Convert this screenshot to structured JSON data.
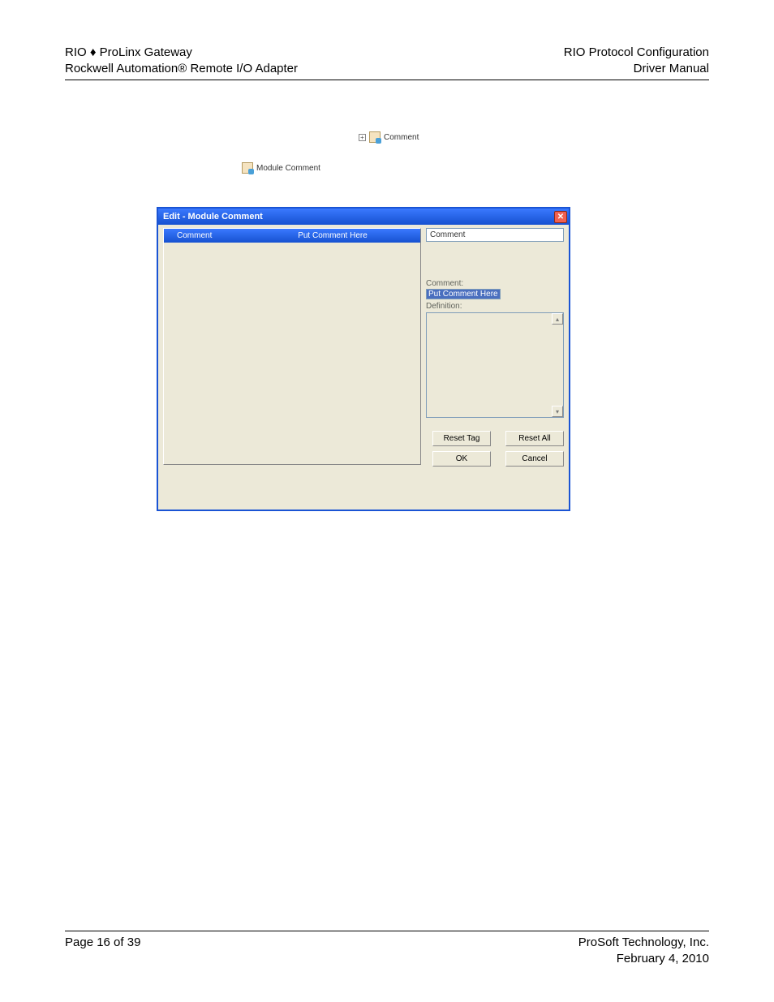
{
  "header": {
    "left1": "RIO ♦ ProLinx Gateway",
    "left2": "Rockwell Automation® Remote I/O Adapter",
    "right1": "RIO Protocol Configuration",
    "right2": "Driver Manual"
  },
  "tree": {
    "item1": "Comment",
    "item2": "Module Comment"
  },
  "dialog": {
    "title": "Edit - Module Comment",
    "grid": {
      "col1": "Comment",
      "col2": "Put Comment Here"
    },
    "search_value": "Comment",
    "comment_label": "Comment:",
    "comment_value": "Put Comment Here",
    "definition_label": "Definition:",
    "buttons": {
      "reset_tag": "Reset Tag",
      "reset_all": "Reset All",
      "ok": "OK",
      "cancel": "Cancel"
    }
  },
  "footer": {
    "left": "Page 16 of 39",
    "right1": "ProSoft Technology, Inc.",
    "right2": "February 4, 2010"
  }
}
